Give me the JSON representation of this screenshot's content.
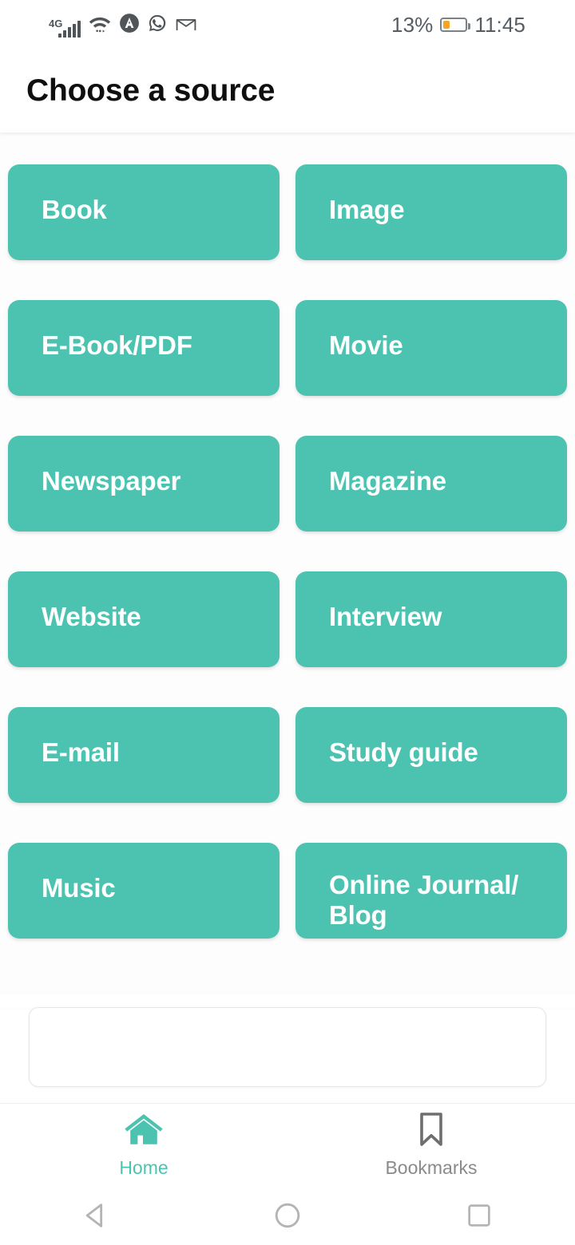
{
  "status_bar": {
    "network": "4G",
    "icons": [
      "signal-bars-icon",
      "wifi-icon",
      "adguard-icon",
      "whatsapp-icon",
      "gmail-icon"
    ],
    "battery_percent": "13%",
    "battery_level": 13,
    "time": "11:45"
  },
  "header": {
    "title": "Choose a source"
  },
  "sources": [
    {
      "label": "Book"
    },
    {
      "label": "Image"
    },
    {
      "label": "E-Book/PDF"
    },
    {
      "label": "Movie"
    },
    {
      "label": "Newspaper"
    },
    {
      "label": "Magazine"
    },
    {
      "label": "Website"
    },
    {
      "label": "Interview"
    },
    {
      "label": "E-mail"
    },
    {
      "label": "Study guide"
    },
    {
      "label": "Music"
    },
    {
      "label": "Online Journal/\nBlog"
    }
  ],
  "tabbar": {
    "tabs": [
      {
        "label": "Home",
        "icon": "home-icon",
        "active": true
      },
      {
        "label": "Bookmarks",
        "icon": "bookmark-icon",
        "active": false
      }
    ]
  },
  "nav_bar": {
    "buttons": [
      "back-icon",
      "home-circle-icon",
      "recents-icon"
    ]
  },
  "colors": {
    "accent": "#4cc3b0",
    "background": "#ffffff",
    "title": "#0f0f0f",
    "battery": "#f5a623",
    "inactive": "#8a8a8a"
  }
}
